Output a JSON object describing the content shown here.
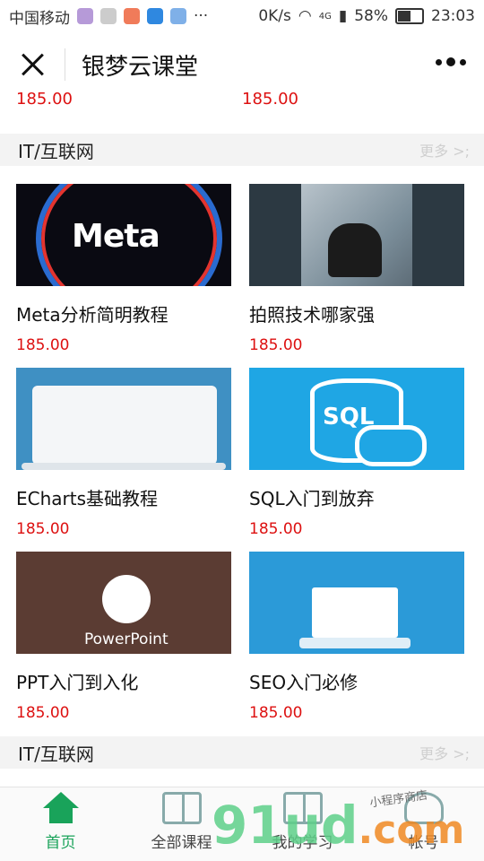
{
  "status": {
    "carrier": "中国移动",
    "speed": "0K/s",
    "net": "4G",
    "battery": "58%",
    "time": "23:03"
  },
  "nav": {
    "title": "银梦云课堂"
  },
  "top_prices": [
    "185.00",
    "185.00"
  ],
  "sections": [
    {
      "title": "IT/互联网",
      "more": "更多 >;",
      "courses": [
        {
          "name": "Meta分析简明教程",
          "price": "185.00",
          "thumb_text": "Meta"
        },
        {
          "name": "拍照技术哪家强",
          "price": "185.00"
        },
        {
          "name": "ECharts基础教程",
          "price": "185.00"
        },
        {
          "name": "SQL入门到放弃",
          "price": "185.00",
          "thumb_text": "SQL"
        },
        {
          "name": "PPT入门到入化",
          "price": "185.00",
          "thumb_text": "PowerPoint"
        },
        {
          "name": "SEO入门必修",
          "price": "185.00"
        }
      ]
    },
    {
      "title": "IT/互联网",
      "more": "更多 >;"
    }
  ],
  "tabs": [
    {
      "label": "首页",
      "icon": "home-icon",
      "active": true
    },
    {
      "label": "全部课程",
      "icon": "book-icon"
    },
    {
      "label": "我的学习",
      "icon": "study-icon"
    },
    {
      "label": "帐号",
      "icon": "user-icon"
    }
  ],
  "watermark": {
    "main": "91ud",
    "com": ".com",
    "tagline": "小程序商店"
  },
  "colors": {
    "price": "#dd1111",
    "accent": "#19a35a"
  }
}
